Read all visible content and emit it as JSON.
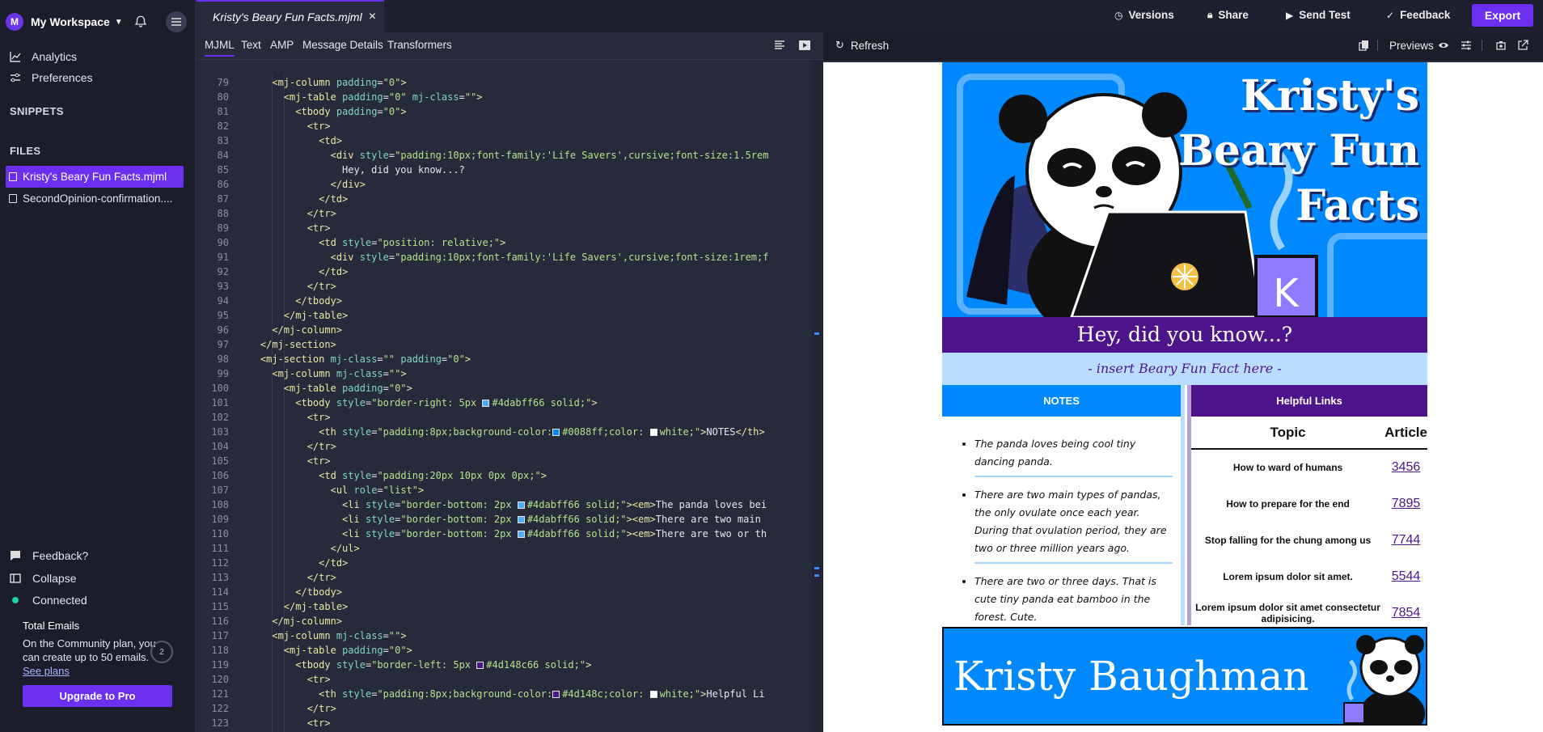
{
  "workspace": {
    "initial": "M",
    "name": "My Workspace"
  },
  "nav": {
    "analytics": "Analytics",
    "preferences": "Preferences"
  },
  "sections": {
    "snippets": "SNIPPETS",
    "files": "FILES"
  },
  "files": [
    {
      "name": "Kristy's Beary Fun Facts.mjml",
      "active": true
    },
    {
      "name": "SecondOpinion-confirmation....",
      "active": false
    }
  ],
  "sidebar_bottom": {
    "feedback": "Feedback?",
    "collapse": "Collapse",
    "connected": "Connected"
  },
  "plan": {
    "title": "Total Emails",
    "text": "On the Community plan, you can create up to 50 emails.",
    "link": "See plans",
    "count": "2",
    "upgrade": "Upgrade to Pro"
  },
  "editor": {
    "file_tab": "Kristy's Beary Fun Facts.mjml",
    "close": "×",
    "tabs": [
      "MJML",
      "Text",
      "AMP",
      "Message Details",
      "Transformers"
    ]
  },
  "code_lines": [
    {
      "n": "79",
      "i": 3,
      "h": "<span class=\"tag\">&lt;mj-column</span> <span class=\"attr\">padding</span>=<span class=\"str\">\"0\"</span><span class=\"tag\">&gt;</span>"
    },
    {
      "n": "80",
      "i": 4,
      "h": "<span class=\"tag\">&lt;mj-table</span> <span class=\"attr\">padding</span>=<span class=\"str\">\"0\"</span> <span class=\"attr\">mj-class</span>=<span class=\"str\">\"\"</span><span class=\"tag\">&gt;</span>"
    },
    {
      "n": "81",
      "i": 5,
      "h": "<span class=\"tag\">&lt;tbody</span> <span class=\"attr\">padding</span>=<span class=\"str\">\"0\"</span><span class=\"tag\">&gt;</span>"
    },
    {
      "n": "82",
      "i": 6,
      "h": "<span class=\"tag\">&lt;tr&gt;</span>"
    },
    {
      "n": "83",
      "i": 7,
      "h": "<span class=\"tag\">&lt;td&gt;</span>"
    },
    {
      "n": "84",
      "i": 8,
      "h": "<span class=\"tag\">&lt;div</span> <span class=\"attr\">style</span>=<span class=\"str\">\"padding:10px;font-family:'Life Savers',cursive;font-size:1.5rem</span>"
    },
    {
      "n": "85",
      "i": 9,
      "h": "<span class=\"txt\">Hey, did you know...?</span>"
    },
    {
      "n": "86",
      "i": 8,
      "h": "<span class=\"tag\">&lt;/div&gt;</span>"
    },
    {
      "n": "87",
      "i": 7,
      "h": "<span class=\"tag\">&lt;/td&gt;</span>"
    },
    {
      "n": "88",
      "i": 6,
      "h": "<span class=\"tag\">&lt;/tr&gt;</span>"
    },
    {
      "n": "89",
      "i": 6,
      "h": "<span class=\"tag\">&lt;tr&gt;</span>"
    },
    {
      "n": "90",
      "i": 7,
      "h": "<span class=\"tag\">&lt;td</span> <span class=\"attr\">style</span>=<span class=\"str\">\"position: relative;\"</span><span class=\"tag\">&gt;</span>"
    },
    {
      "n": "91",
      "i": 8,
      "h": "<span class=\"tag\">&lt;div</span> <span class=\"attr\">style</span>=<span class=\"str\">\"padding:10px;font-family:'Life Savers',cursive;font-size:1rem;f</span>"
    },
    {
      "n": "92",
      "i": 7,
      "h": "<span class=\"tag\">&lt;/td&gt;</span>"
    },
    {
      "n": "93",
      "i": 6,
      "h": "<span class=\"tag\">&lt;/tr&gt;</span>"
    },
    {
      "n": "94",
      "i": 5,
      "h": "<span class=\"tag\">&lt;/tbody&gt;</span>"
    },
    {
      "n": "95",
      "i": 4,
      "h": "<span class=\"tag\">&lt;/mj-table&gt;</span>"
    },
    {
      "n": "96",
      "i": 3,
      "h": "<span class=\"tag\">&lt;/mj-column&gt;</span>"
    },
    {
      "n": "97",
      "i": 2,
      "h": "<span class=\"tag\">&lt;/mj-section&gt;</span>"
    },
    {
      "n": "98",
      "i": 2,
      "h": "<span class=\"tag\">&lt;mj-section</span> <span class=\"attr\">mj-class</span>=<span class=\"str\">\"\"</span> <span class=\"attr\">padding</span>=<span class=\"str\">\"0\"</span><span class=\"tag\">&gt;</span>"
    },
    {
      "n": "99",
      "i": 3,
      "h": "<span class=\"tag\">&lt;mj-column</span> <span class=\"attr\">mj-class</span>=<span class=\"str\">\"\"</span><span class=\"tag\">&gt;</span>"
    },
    {
      "n": "100",
      "i": 4,
      "h": "<span class=\"tag\">&lt;mj-table</span> <span class=\"attr\">padding</span>=<span class=\"str\">\"0\"</span><span class=\"tag\">&gt;</span>"
    },
    {
      "n": "101",
      "i": 5,
      "h": "<span class=\"tag\">&lt;tbody</span> <span class=\"attr\">style</span>=<span class=\"str\">\"border-right: 5px <span class=\"sw\" style=\"background:#4dabff\"></span>#4dabff66 solid;\"</span><span class=\"tag\">&gt;</span>"
    },
    {
      "n": "102",
      "i": 6,
      "h": "<span class=\"tag\">&lt;tr&gt;</span>"
    },
    {
      "n": "103",
      "i": 7,
      "h": "<span class=\"tag\">&lt;th</span> <span class=\"attr\">style</span>=<span class=\"str\">\"padding:8px;background-color:<span class=\"sw\" style=\"background:#0088ff\"></span>#0088ff;color: <span class=\"sw\" style=\"background:#ffffff\"></span>white;\"</span><span class=\"tag\">&gt;</span><span class=\"txt\">NOTES</span><span class=\"tag\">&lt;/th&gt;</span>"
    },
    {
      "n": "104",
      "i": 6,
      "h": "<span class=\"tag\">&lt;/tr&gt;</span>"
    },
    {
      "n": "105",
      "i": 6,
      "h": "<span class=\"tag\">&lt;tr&gt;</span>"
    },
    {
      "n": "106",
      "i": 7,
      "h": "<span class=\"tag\">&lt;td</span> <span class=\"attr\">style</span>=<span class=\"str\">\"padding:20px 10px 0px 0px;\"</span><span class=\"tag\">&gt;</span>"
    },
    {
      "n": "107",
      "i": 8,
      "h": "<span class=\"tag\">&lt;ul</span> <span class=\"attr\">role</span>=<span class=\"str\">\"list\"</span><span class=\"tag\">&gt;</span>"
    },
    {
      "n": "108",
      "i": 9,
      "h": "<span class=\"tag\">&lt;li</span> <span class=\"attr\">style</span>=<span class=\"str\">\"border-bottom: 2px <span class=\"sw\" style=\"background:#4dabff\"></span>#4dabff66 solid;\"</span><span class=\"tag\">&gt;&lt;em&gt;</span><span class=\"txt\">The panda loves bei</span>"
    },
    {
      "n": "109",
      "i": 9,
      "h": "<span class=\"tag\">&lt;li</span> <span class=\"attr\">style</span>=<span class=\"str\">\"border-bottom: 2px <span class=\"sw\" style=\"background:#4dabff\"></span>#4dabff66 solid;\"</span><span class=\"tag\">&gt;&lt;em&gt;</span><span class=\"txt\">There are two main </span>"
    },
    {
      "n": "110",
      "i": 9,
      "h": "<span class=\"tag\">&lt;li</span> <span class=\"attr\">style</span>=<span class=\"str\">\"border-bottom: 2px <span class=\"sw\" style=\"background:#4dabff\"></span>#4dabff66 solid;\"</span><span class=\"tag\">&gt;&lt;em&gt;</span><span class=\"txt\">There are two or th</span>"
    },
    {
      "n": "111",
      "i": 8,
      "h": "<span class=\"tag\">&lt;/ul&gt;</span>"
    },
    {
      "n": "112",
      "i": 7,
      "h": "<span class=\"tag\">&lt;/td&gt;</span>"
    },
    {
      "n": "113",
      "i": 6,
      "h": "<span class=\"tag\">&lt;/tr&gt;</span>"
    },
    {
      "n": "114",
      "i": 5,
      "h": "<span class=\"tag\">&lt;/tbody&gt;</span>"
    },
    {
      "n": "115",
      "i": 4,
      "h": "<span class=\"tag\">&lt;/mj-table&gt;</span>"
    },
    {
      "n": "116",
      "i": 3,
      "h": "<span class=\"tag\">&lt;/mj-column&gt;</span>"
    },
    {
      "n": "117",
      "i": 3,
      "h": "<span class=\"tag\">&lt;mj-column</span> <span class=\"attr\">mj-class</span>=<span class=\"str\">\"\"</span><span class=\"tag\">&gt;</span>"
    },
    {
      "n": "118",
      "i": 4,
      "h": "<span class=\"tag\">&lt;mj-table</span> <span class=\"attr\">padding</span>=<span class=\"str\">\"0\"</span><span class=\"tag\">&gt;</span>"
    },
    {
      "n": "119",
      "i": 5,
      "h": "<span class=\"tag\">&lt;tbody</span> <span class=\"attr\">style</span>=<span class=\"str\">\"border-left: 5px <span class=\"sw\" style=\"background:#4d148c\"></span>#4d148c66 solid;\"</span><span class=\"tag\">&gt;</span>"
    },
    {
      "n": "120",
      "i": 6,
      "h": "<span class=\"tag\">&lt;tr&gt;</span>"
    },
    {
      "n": "121",
      "i": 7,
      "h": "<span class=\"tag\">&lt;th</span> <span class=\"attr\">style</span>=<span class=\"str\">\"padding:8px;background-color:<span class=\"sw\" style=\"background:#4d148c\"></span>#4d148c;color: <span class=\"sw\" style=\"background:#ffffff\"></span>white;\"</span><span class=\"tag\">&gt;</span><span class=\"txt\">Helpful Li</span>"
    },
    {
      "n": "122",
      "i": 6,
      "h": "<span class=\"tag\">&lt;/tr&gt;</span>"
    },
    {
      "n": "123",
      "i": 6,
      "h": "<span class=\"tag\">&lt;tr&gt;</span>"
    }
  ],
  "toolbar": {
    "versions": "Versions",
    "share": "Share",
    "send_test": "Send Test",
    "feedback": "Feedback",
    "export": "Export"
  },
  "preview_bar": {
    "refresh": "Refresh",
    "previews": "Previews"
  },
  "email": {
    "title_lines": [
      "Kristy's",
      "Beary Fun",
      "Facts"
    ],
    "hey": "Hey, did you know...?",
    "insert": "- insert Beary Fun Fact here -",
    "notes_header": "NOTES",
    "notes": [
      "The panda loves being cool tiny dancing panda.",
      "There are two main types of pandas, the only ovulate once each year. During that ovulation period, they are two or three million years ago.",
      "There are two or three days. That is cute tiny panda eat bamboo in the forest. Cute."
    ],
    "links_header": "Helpful Links",
    "links_cols": [
      "Topic",
      "Article"
    ],
    "links_rows": [
      {
        "topic": "How to ward of humans",
        "article": "3456"
      },
      {
        "topic": "How to prepare for the end",
        "article": "7895"
      },
      {
        "topic": "Stop falling for the chung among us",
        "article": "7744"
      },
      {
        "topic": "Lorem ipsum dolor sit amet.",
        "article": "5544"
      },
      {
        "topic": "Lorem ipsum dolor sit amet consectetur adipisicing.",
        "article": "7854"
      }
    ],
    "footer_name": "Kristy Baughman",
    "mug_letter": "K"
  },
  "colors": {
    "accent": "#6b2ff0",
    "blue": "#0088ff",
    "purple": "#4d148c",
    "light_blue": "#b9dcff"
  }
}
